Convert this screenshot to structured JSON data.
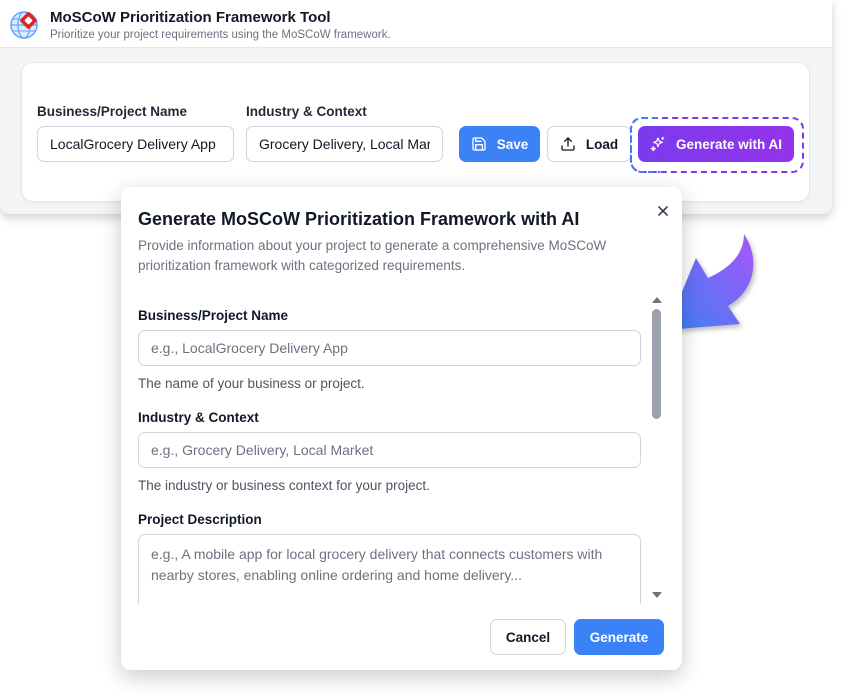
{
  "app": {
    "title": "MoSCoW Prioritization Framework Tool",
    "subtitle": "Prioritize your project requirements using the MoSCoW framework.",
    "logo_icon": "globe-logo-icon"
  },
  "top_panel": {
    "business_label": "Business/Project Name",
    "business_value": "LocalGrocery Delivery App",
    "industry_label": "Industry & Context",
    "industry_value": "Grocery Delivery, Local Market",
    "save_label": "Save",
    "save_icon": "floppy-disk-icon",
    "load_label": "Load",
    "load_icon": "upload-icon",
    "ai_label": "Generate with AI",
    "ai_icon": "sparkles-icon"
  },
  "dialog": {
    "title": "Generate MoSCoW Prioritization Framework with AI",
    "description": "Provide information about your project to generate a comprehensive MoSCoW prioritization framework with categorized requirements.",
    "fields": [
      {
        "label": "Business/Project Name",
        "placeholder": "e.g., LocalGrocery Delivery App",
        "help": "The name of your business or project."
      },
      {
        "label": "Industry & Context",
        "placeholder": "e.g., Grocery Delivery, Local Market",
        "help": "The industry or business context for your project."
      },
      {
        "label": "Project Description",
        "placeholder": "e.g., A mobile app for local grocery delivery that connects customers with nearby stores, enabling online ordering and home delivery..."
      }
    ],
    "cancel_label": "Cancel",
    "generate_label": "Generate"
  },
  "colors": {
    "primary_blue": "#3b82f6",
    "ai_purple": "#7c3aed",
    "arrow_gradient_start": "#3b82f6",
    "arrow_gradient_end": "#a855f7"
  }
}
